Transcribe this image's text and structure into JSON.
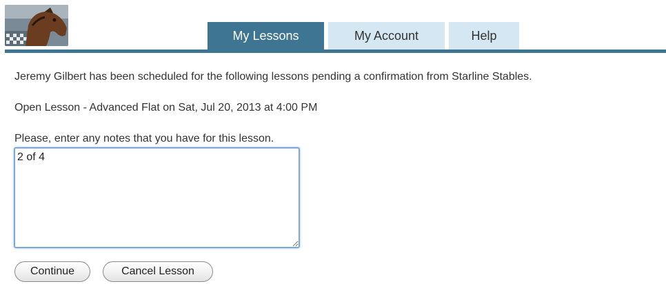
{
  "tabs": [
    {
      "label": "My Lessons",
      "active": true
    },
    {
      "label": "My Account",
      "active": false
    },
    {
      "label": "Help",
      "active": false
    }
  ],
  "messages": {
    "scheduled": "Jeremy Gilbert has been scheduled for the following lessons pending a confirmation from Starline Stables.",
    "lesson": "Open Lesson - Advanced Flat on Sat, Jul 20, 2013 at 4:00 PM",
    "notes_prompt": "Please, enter any notes that you have for this lesson."
  },
  "notes": {
    "value": "2 of 4"
  },
  "buttons": {
    "continue": "Continue",
    "cancel": "Cancel Lesson"
  },
  "colors": {
    "accent": "#3e7592",
    "tab_inactive": "#d4e7f2"
  }
}
